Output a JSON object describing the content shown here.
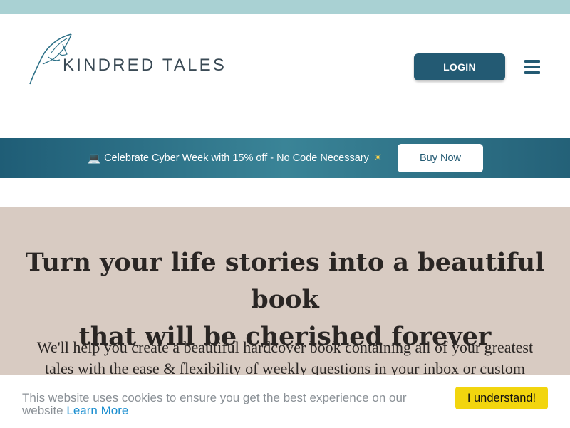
{
  "header": {
    "brand": "KINDRED TALES",
    "login_label": "LOGIN"
  },
  "promo": {
    "icon": "laptop-icon",
    "text": "Celebrate Cyber Week with 15% off - No Code Necessary",
    "emoji": "sun-icon",
    "button_label": "Buy Now"
  },
  "hero": {
    "title_line1": "Turn your life stories into a beautiful book",
    "title_line2": "that will be cherished forever",
    "description": "We'll help you create a beautiful hardcover book containing all of your greatest tales with the ease & flexibility of weekly questions in your inbox or custom"
  },
  "cookie": {
    "text": "This website uses cookies to ensure you get the best experience on our website",
    "link_label": "Learn More",
    "button_label": "I understand!"
  },
  "colors": {
    "top_strip": "#a9d1d3",
    "brand_teal": "#235a73",
    "hero_bg": "#d8cbc2",
    "cookie_button": "#f2d50e",
    "link": "#1c8fd0"
  }
}
